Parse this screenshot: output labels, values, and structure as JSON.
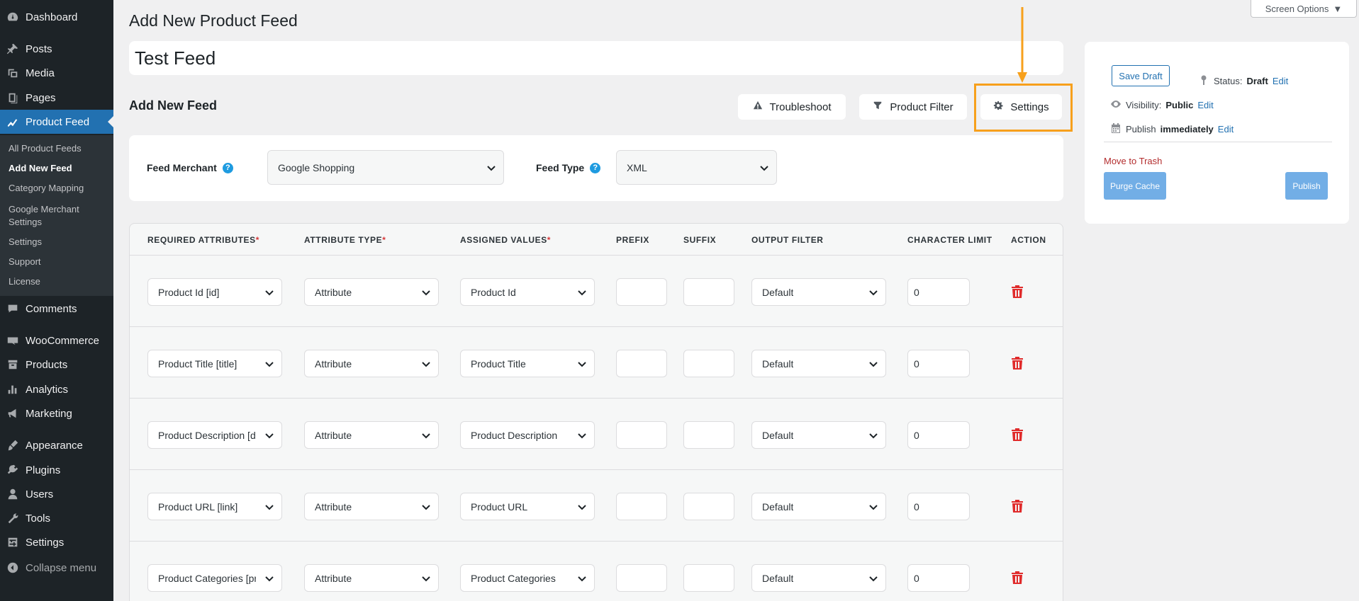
{
  "sidebar": {
    "menu": [
      {
        "label": "Dashboard",
        "icon": "dashboard-icon"
      },
      {
        "label": "Posts",
        "icon": "pin-icon"
      },
      {
        "label": "Media",
        "icon": "media-icon"
      },
      {
        "label": "Pages",
        "icon": "pages-icon"
      },
      {
        "label": "Product Feed",
        "icon": "chart-line-icon"
      },
      {
        "label": "Comments",
        "icon": "comment-icon"
      },
      {
        "label": "WooCommerce",
        "icon": "woo-icon"
      },
      {
        "label": "Products",
        "icon": "archive-icon"
      },
      {
        "label": "Analytics",
        "icon": "bar-chart-icon"
      },
      {
        "label": "Marketing",
        "icon": "megaphone-icon"
      },
      {
        "label": "Appearance",
        "icon": "brush-icon"
      },
      {
        "label": "Plugins",
        "icon": "plug-icon"
      },
      {
        "label": "Users",
        "icon": "user-icon"
      },
      {
        "label": "Tools",
        "icon": "wrench-icon"
      },
      {
        "label": "Settings",
        "icon": "settings-sliders-icon"
      }
    ],
    "submenu": [
      "All Product Feeds",
      "Add New Feed",
      "Category Mapping",
      "Google Merchant",
      "Settings",
      "Settings",
      "Support",
      "License"
    ],
    "collapse_label": "Collapse menu"
  },
  "header": {
    "page_title": "Add New Product Feed",
    "screen_options": "Screen Options",
    "feed_title": "Test Feed",
    "section_title": "Add New Feed"
  },
  "toolbar": {
    "troubleshoot": "Troubleshoot",
    "product_filter": "Product Filter",
    "settings": "Settings",
    "highlight_color": "#f7a01c"
  },
  "merchant": {
    "merchant_label": "Feed Merchant",
    "merchant_value": "Google Shopping",
    "type_label": "Feed Type",
    "type_value": "XML",
    "help": "?"
  },
  "table": {
    "headers": {
      "required": "REQUIRED ATTRIBUTES",
      "type": "ATTRIBUTE TYPE",
      "assigned": "ASSIGNED VALUES",
      "prefix": "PREFIX",
      "suffix": "SUFFIX",
      "output": "OUTPUT FILTER",
      "limit": "CHARACTER LIMIT",
      "action": "ACTION",
      "asterisk": "*"
    },
    "rows": [
      {
        "required": "Product Id [id]",
        "type": "Attribute",
        "assigned": "Product Id",
        "prefix": "",
        "suffix": "",
        "output": "Default",
        "limit": "0"
      },
      {
        "required": "Product Title [title]",
        "type": "Attribute",
        "assigned": "Product Title",
        "prefix": "",
        "suffix": "",
        "output": "Default",
        "limit": "0"
      },
      {
        "required": "Product Description [description]",
        "type": "Attribute",
        "assigned": "Product Description",
        "prefix": "",
        "suffix": "",
        "output": "Default",
        "limit": "0"
      },
      {
        "required": "Product URL [link]",
        "type": "Attribute",
        "assigned": "Product URL",
        "prefix": "",
        "suffix": "",
        "output": "Default",
        "limit": "0"
      },
      {
        "required": "Product Categories [product_type]",
        "type": "Attribute",
        "assigned": "Product Categories",
        "prefix": "",
        "suffix": "",
        "output": "Default",
        "limit": "0"
      }
    ]
  },
  "publish": {
    "save_draft": "Save Draft",
    "status_label": "Status:",
    "status_value": "Draft",
    "visibility_label": "Visibility:",
    "visibility_value": "Public",
    "publish_label": "Publish",
    "publish_value": "immediately",
    "edit": "Edit",
    "move_to_trash": "Move to Trash",
    "purge_cache": "Purge Cache",
    "publish_button": "Publish"
  }
}
